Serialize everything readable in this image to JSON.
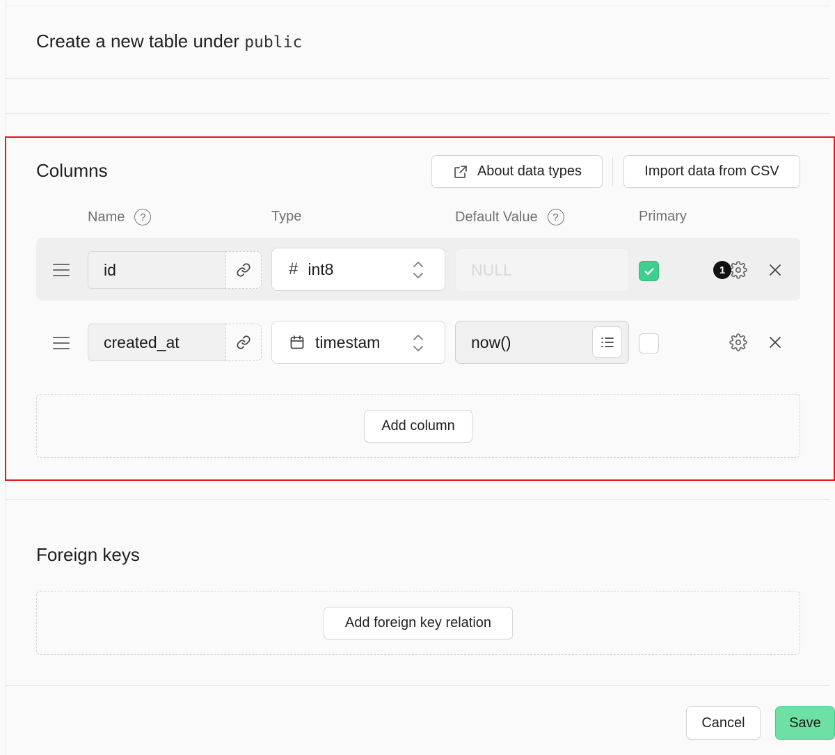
{
  "header": {
    "title_prefix": "Create a new table under",
    "schema": "public"
  },
  "columns_section": {
    "title": "Columns",
    "about_button": "About data types",
    "import_button": "Import data from CSV",
    "headers": {
      "name": "Name",
      "type": "Type",
      "default_value": "Default Value",
      "primary": "Primary"
    },
    "help_glyph": "?",
    "rows": [
      {
        "name": "id",
        "type": "int8",
        "type_icon": "hash-icon",
        "type_glyph": "#",
        "default_value": "",
        "default_placeholder": "NULL",
        "primary": true,
        "badge": "1"
      },
      {
        "name": "created_at",
        "type": "timestam",
        "type_icon": "calendar-icon",
        "default_value": "now()",
        "default_placeholder": "",
        "primary": false
      }
    ],
    "add_column_button": "Add column"
  },
  "foreign_keys_section": {
    "title": "Foreign keys",
    "add_relation_button": "Add foreign key relation"
  },
  "footer": {
    "cancel_button": "Cancel",
    "save_button": "Save"
  },
  "colors": {
    "accent_green": "#3ecf8e",
    "highlight_border": "#e3151c"
  }
}
